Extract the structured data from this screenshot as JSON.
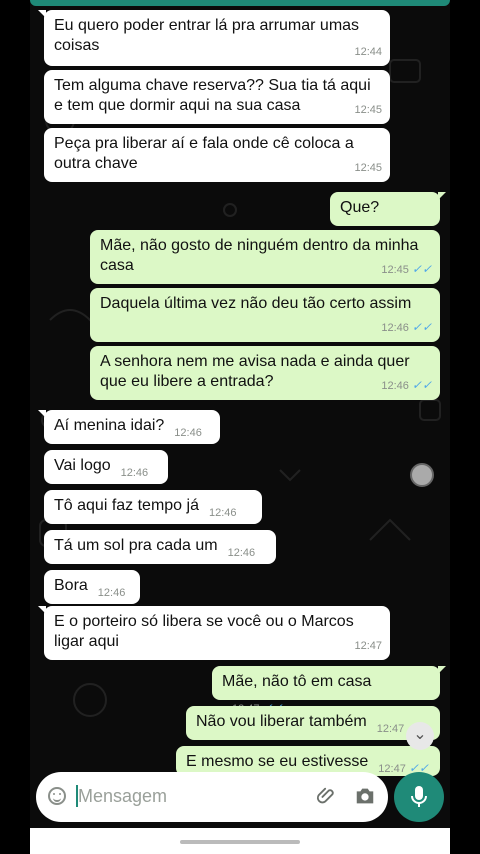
{
  "chat": {
    "messages": [
      {
        "dir": "in",
        "text": "Eu quero poder entrar lá pra arrumar umas coisas",
        "time": "12:44"
      },
      {
        "dir": "in",
        "text": "Tem alguma chave reserva?? Sua tia tá aqui e tem que dormir aqui na sua casa",
        "time": "12:45"
      },
      {
        "dir": "in",
        "text": "Peça pra liberar aí e fala onde cê coloca a outra chave",
        "time": "12:45"
      },
      {
        "dir": "out",
        "text": "Que?",
        "time": "12:45"
      },
      {
        "dir": "out",
        "text": "Mãe, não gosto de ninguém dentro da minha casa",
        "time": "12:45"
      },
      {
        "dir": "out",
        "text": "Daquela última vez não deu tão certo assim",
        "time": "12:46"
      },
      {
        "dir": "out",
        "text": "A senhora nem me avisa nada e ainda quer que eu libere a entrada?",
        "time": "12:46"
      },
      {
        "dir": "in",
        "text": "Aí menina idai?",
        "time": "12:46"
      },
      {
        "dir": "in",
        "text": "Vai logo",
        "time": "12:46"
      },
      {
        "dir": "in",
        "text": "Tô aqui faz tempo já",
        "time": "12:46"
      },
      {
        "dir": "in",
        "text": "Tá um sol pra cada um",
        "time": "12:46"
      },
      {
        "dir": "in",
        "text": "Bora",
        "time": "12:46"
      },
      {
        "dir": "in",
        "text": "E o porteiro só libera se você ou o Marcos ligar aqui",
        "time": "12:47"
      },
      {
        "dir": "out",
        "text": "Mãe, não tô em casa",
        "time": "12:47"
      },
      {
        "dir": "out",
        "text": "Não vou liberar também",
        "time": "12:47"
      },
      {
        "dir": "out",
        "text": "E mesmo se eu estivesse",
        "time": "12:47"
      }
    ]
  },
  "composer": {
    "placeholder": "Mensagem",
    "emoji_icon": "emoji-icon",
    "attach_icon": "paperclip-icon",
    "camera_icon": "camera-icon",
    "mic_icon": "microphone-icon"
  },
  "colors": {
    "incoming": "#ffffff",
    "outgoing": "#dcf8c6",
    "accent": "#1f8a78",
    "read_check": "#4fa7e8"
  }
}
